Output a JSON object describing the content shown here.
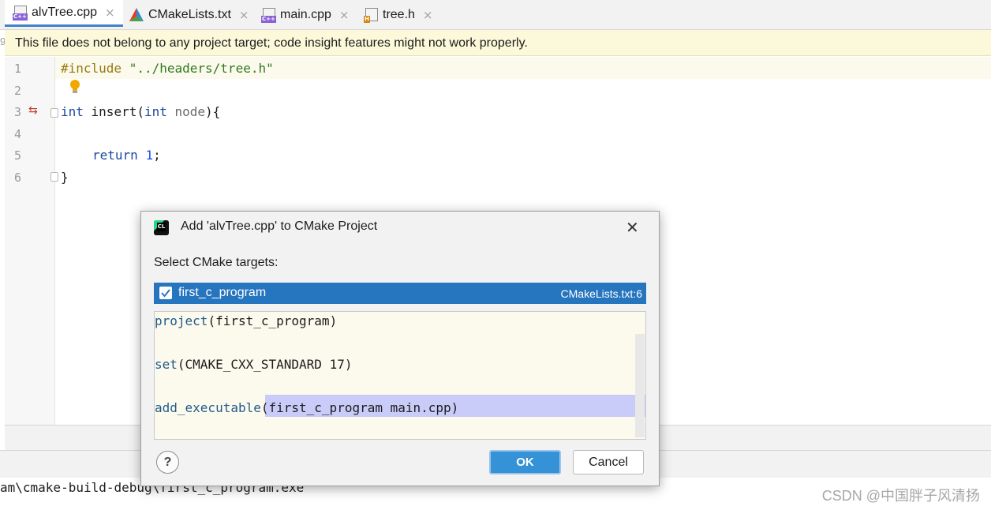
{
  "tabs": [
    {
      "label": "alvTree.cpp",
      "icon": "cpp-file-icon",
      "badge": "C++"
    },
    {
      "label": "CMakeLists.txt",
      "icon": "cmake-icon"
    },
    {
      "label": "main.cpp",
      "icon": "cpp-file-icon",
      "badge": "C++"
    },
    {
      "label": "tree.h",
      "icon": "header-file-icon",
      "badge": "H"
    }
  ],
  "banner": {
    "text": "This file does not belong to any project target; code insight features might not work properly.",
    "edge_char": "9"
  },
  "editor": {
    "line_numbers": [
      "1",
      "2",
      "3",
      "4",
      "5",
      "6"
    ],
    "lines": {
      "l1_directive": "#include",
      "l1_string": "\"../headers/tree.h\"",
      "l3_kw1": "int",
      "l3_fn": " insert(",
      "l3_kw2": "int",
      "l3_param": " node",
      "l3_end": "){",
      "l5_kw": "return",
      "l5_num": "1",
      "l5_end": ";",
      "l6": "}"
    }
  },
  "console_text": "am\\cmake-build-debug\\first_c_program.exe",
  "watermark": "CSDN @中国胖子风清扬",
  "dialog": {
    "title": "Add 'alvTree.cpp' to CMake Project",
    "logo_text": "CL",
    "label": "Select CMake targets:",
    "target": {
      "name": "first_c_program",
      "source": "CMakeLists.txt:6",
      "checked": true
    },
    "preview": {
      "line1_fn": "project",
      "line1_args": "(first_c_program)",
      "line2_fn": "set",
      "line2_args": "(CMAKE_CXX_STANDARD 17)",
      "line3_fn": "add_executable",
      "line3_args": "(first_c_program main.cpp)"
    },
    "help_label": "?",
    "ok_label": "OK",
    "cancel_label": "Cancel"
  },
  "colors": {
    "accent": "#2675bf",
    "banner": "#fbf9d9",
    "ok": "#3592d6"
  }
}
